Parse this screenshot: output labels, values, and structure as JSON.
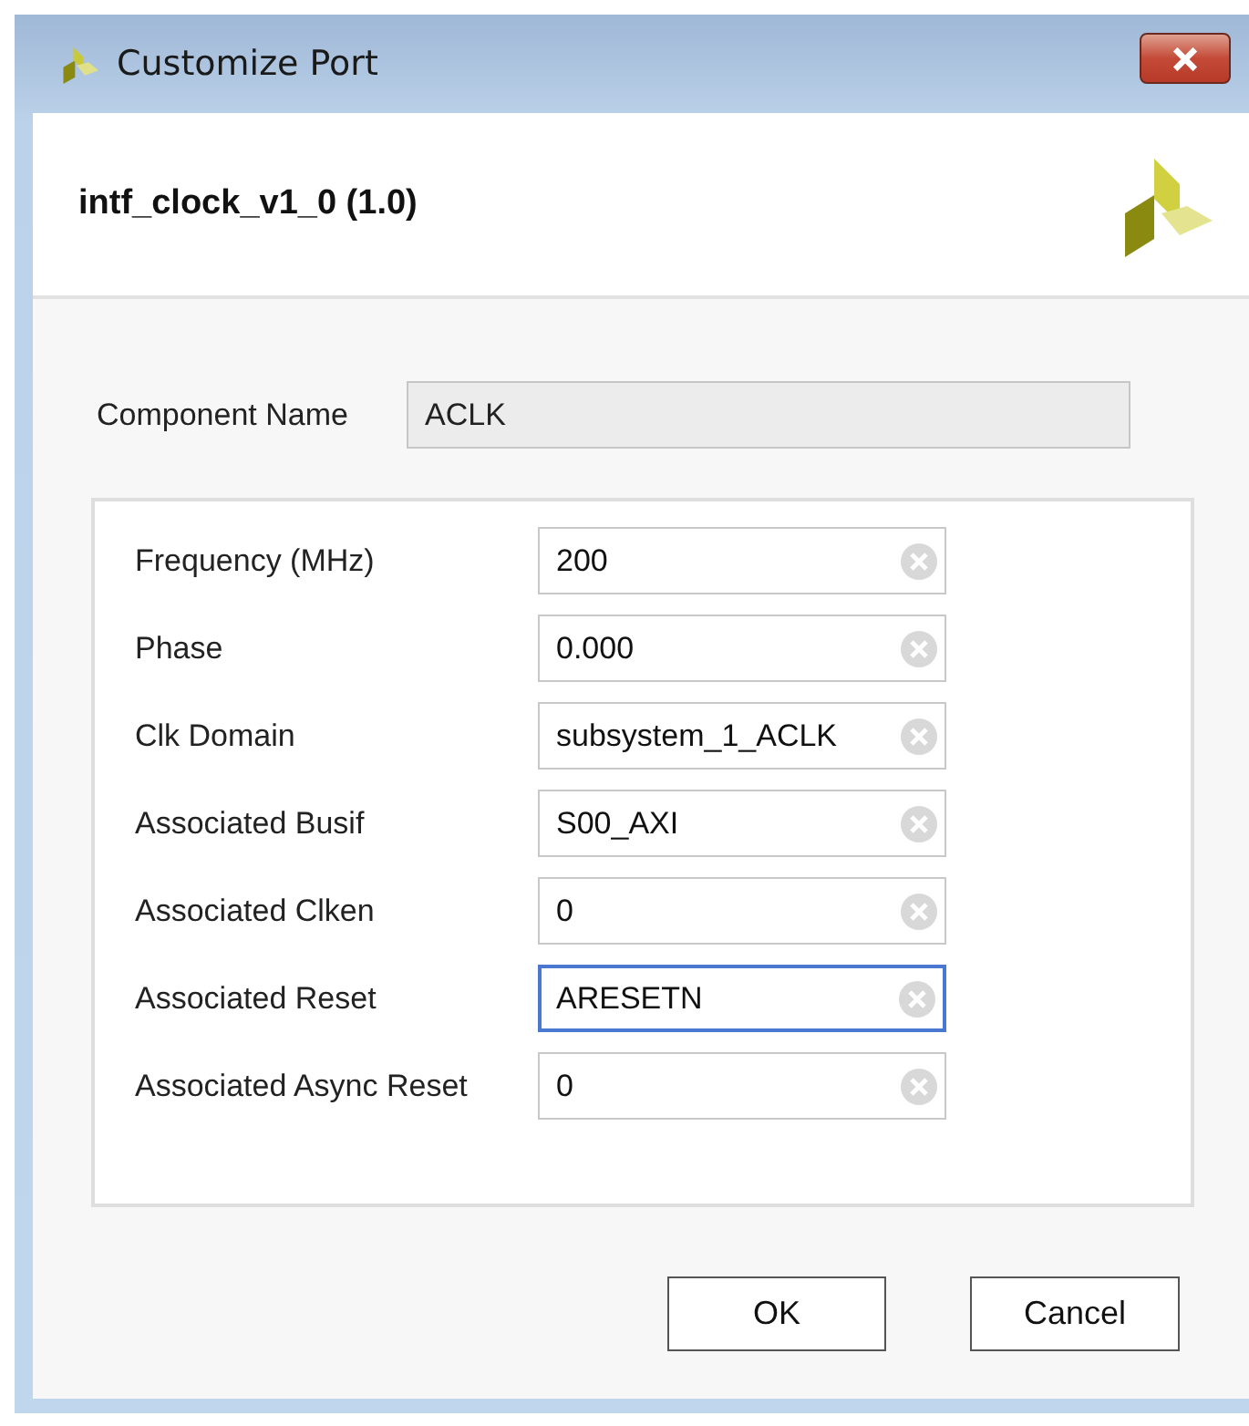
{
  "window": {
    "title": "Customize Port"
  },
  "header": {
    "title": "intf_clock_v1_0 (1.0)"
  },
  "component_name": {
    "label": "Component Name",
    "value": "ACLK"
  },
  "fields": [
    {
      "label": "Frequency (MHz)",
      "value": "200",
      "focused": false
    },
    {
      "label": "Phase",
      "value": "0.000",
      "focused": false
    },
    {
      "label": "Clk Domain",
      "value": "subsystem_1_ACLK",
      "focused": false
    },
    {
      "label": "Associated Busif",
      "value": "S00_AXI",
      "focused": false
    },
    {
      "label": "Associated Clken",
      "value": "0",
      "focused": false
    },
    {
      "label": "Associated Reset",
      "value": "ARESETN",
      "focused": true
    },
    {
      "label": "Associated Async Reset",
      "value": "0",
      "focused": false
    }
  ],
  "buttons": [
    "OK",
    "Cancel"
  ]
}
